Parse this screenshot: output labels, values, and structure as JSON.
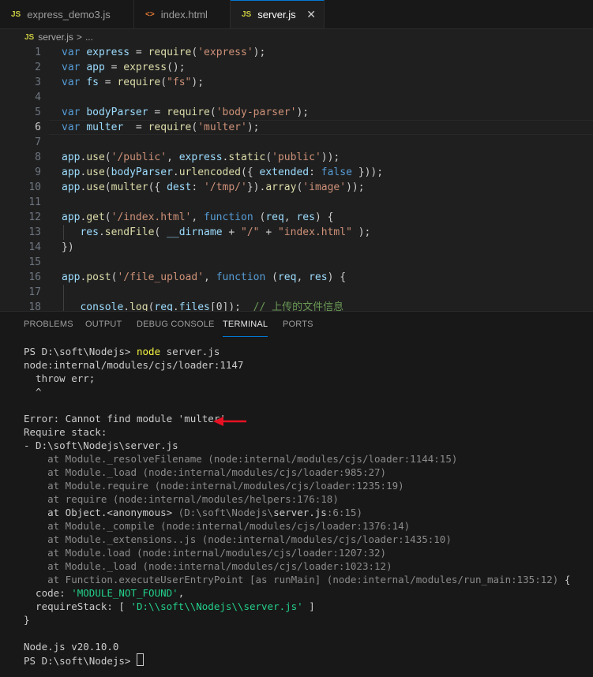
{
  "tabs": [
    {
      "icon": "JS",
      "label": "express_demo3.js",
      "active": false
    },
    {
      "icon": "<>",
      "label": "index.html",
      "active": false
    },
    {
      "icon": "JS",
      "label": "server.js",
      "active": true
    }
  ],
  "tab_close": "✕",
  "breadcrumb": {
    "icon": "JS",
    "file": "server.js",
    "sep": ">",
    "rest": "..."
  },
  "code_lines": [
    {
      "n": "1",
      "tokens": [
        [
          "kw",
          "var"
        ],
        [
          "p",
          " "
        ],
        [
          "var",
          "express"
        ],
        [
          "p",
          " = "
        ],
        [
          "fn",
          "require"
        ],
        [
          "p",
          "("
        ],
        [
          "str",
          "'express'"
        ],
        [
          "p",
          ");"
        ]
      ]
    },
    {
      "n": "2",
      "tokens": [
        [
          "kw",
          "var"
        ],
        [
          "p",
          " "
        ],
        [
          "var",
          "app"
        ],
        [
          "p",
          " = "
        ],
        [
          "fn",
          "express"
        ],
        [
          "p",
          "();"
        ]
      ]
    },
    {
      "n": "3",
      "tokens": [
        [
          "kw",
          "var"
        ],
        [
          "p",
          " "
        ],
        [
          "var",
          "fs"
        ],
        [
          "p",
          " = "
        ],
        [
          "fn",
          "require"
        ],
        [
          "p",
          "("
        ],
        [
          "str",
          "\"fs\""
        ],
        [
          "p",
          ");"
        ]
      ]
    },
    {
      "n": "4",
      "tokens": []
    },
    {
      "n": "5",
      "tokens": [
        [
          "kw",
          "var"
        ],
        [
          "p",
          " "
        ],
        [
          "var",
          "bodyParser"
        ],
        [
          "p",
          " = "
        ],
        [
          "fn",
          "require"
        ],
        [
          "p",
          "("
        ],
        [
          "str",
          "'body-parser'"
        ],
        [
          "p",
          ");"
        ]
      ]
    },
    {
      "n": "6",
      "tokens": [
        [
          "kw",
          "var"
        ],
        [
          "p",
          " "
        ],
        [
          "var",
          "multer"
        ],
        [
          "p",
          "  = "
        ],
        [
          "fn",
          "require"
        ],
        [
          "p",
          "("
        ],
        [
          "str",
          "'multer'"
        ],
        [
          "p",
          ");"
        ]
      ]
    },
    {
      "n": "7",
      "tokens": []
    },
    {
      "n": "8",
      "tokens": [
        [
          "var",
          "app"
        ],
        [
          "p",
          "."
        ],
        [
          "fn",
          "use"
        ],
        [
          "p",
          "("
        ],
        [
          "str",
          "'/public'"
        ],
        [
          "p",
          ", "
        ],
        [
          "var",
          "express"
        ],
        [
          "p",
          "."
        ],
        [
          "fn",
          "static"
        ],
        [
          "p",
          "("
        ],
        [
          "str",
          "'public'"
        ],
        [
          "p",
          "));"
        ]
      ]
    },
    {
      "n": "9",
      "tokens": [
        [
          "var",
          "app"
        ],
        [
          "p",
          "."
        ],
        [
          "fn",
          "use"
        ],
        [
          "p",
          "("
        ],
        [
          "var",
          "bodyParser"
        ],
        [
          "p",
          "."
        ],
        [
          "fn",
          "urlencoded"
        ],
        [
          "p",
          "({ "
        ],
        [
          "var",
          "extended"
        ],
        [
          "p",
          ": "
        ],
        [
          "kw",
          "false"
        ],
        [
          "p",
          " }));"
        ]
      ]
    },
    {
      "n": "10",
      "tokens": [
        [
          "var",
          "app"
        ],
        [
          "p",
          "."
        ],
        [
          "fn",
          "use"
        ],
        [
          "p",
          "("
        ],
        [
          "fn",
          "multer"
        ],
        [
          "p",
          "({ "
        ],
        [
          "var",
          "dest"
        ],
        [
          "p",
          ": "
        ],
        [
          "str",
          "'/tmp/'"
        ],
        [
          "p",
          "})."
        ],
        [
          "fn",
          "array"
        ],
        [
          "p",
          "("
        ],
        [
          "str",
          "'image'"
        ],
        [
          "p",
          "));"
        ]
      ]
    },
    {
      "n": "11",
      "tokens": []
    },
    {
      "n": "12",
      "tokens": [
        [
          "var",
          "app"
        ],
        [
          "p",
          "."
        ],
        [
          "fn",
          "get"
        ],
        [
          "p",
          "("
        ],
        [
          "str",
          "'/index.html'"
        ],
        [
          "p",
          ", "
        ],
        [
          "kw",
          "function"
        ],
        [
          "p",
          " ("
        ],
        [
          "var",
          "req"
        ],
        [
          "p",
          ", "
        ],
        [
          "var",
          "res"
        ],
        [
          "p",
          ") {"
        ]
      ]
    },
    {
      "n": "13",
      "tokens": [
        [
          "p",
          "   "
        ],
        [
          "var",
          "res"
        ],
        [
          "p",
          "."
        ],
        [
          "fn",
          "sendFile"
        ],
        [
          "p",
          "( "
        ],
        [
          "var",
          "__dirname"
        ],
        [
          "p",
          " + "
        ],
        [
          "str",
          "\"/\""
        ],
        [
          "p",
          " + "
        ],
        [
          "str",
          "\"index.html\""
        ],
        [
          "p",
          " );"
        ]
      ]
    },
    {
      "n": "14",
      "tokens": [
        [
          "p",
          "})"
        ]
      ]
    },
    {
      "n": "15",
      "tokens": []
    },
    {
      "n": "16",
      "tokens": [
        [
          "var",
          "app"
        ],
        [
          "p",
          "."
        ],
        [
          "fn",
          "post"
        ],
        [
          "p",
          "("
        ],
        [
          "str",
          "'/file_upload'"
        ],
        [
          "p",
          ", "
        ],
        [
          "kw",
          "function"
        ],
        [
          "p",
          " ("
        ],
        [
          "var",
          "req"
        ],
        [
          "p",
          ", "
        ],
        [
          "var",
          "res"
        ],
        [
          "p",
          ") {"
        ]
      ]
    },
    {
      "n": "17",
      "tokens": []
    },
    {
      "n": "18",
      "tokens": [
        [
          "p",
          "   "
        ],
        [
          "var",
          "console"
        ],
        [
          "p",
          "."
        ],
        [
          "fn",
          "log"
        ],
        [
          "p",
          "("
        ],
        [
          "var",
          "req"
        ],
        [
          "p",
          "."
        ],
        [
          "var",
          "files"
        ],
        [
          "p",
          "[0]);  "
        ],
        [
          "cm",
          "// 上传的文件信息"
        ]
      ]
    }
  ],
  "panel_tabs": [
    "PROBLEMS",
    "OUTPUT",
    "DEBUG CONSOLE",
    "TERMINAL",
    "PORTS"
  ],
  "terminal": [
    [
      [
        "p",
        "PS D:\\soft\\Nodejs> "
      ],
      [
        "y",
        "node"
      ],
      [
        "p",
        " server.js"
      ]
    ],
    [
      [
        "p",
        "node:internal/modules/cjs/loader:1147"
      ]
    ],
    [
      [
        "p",
        "  throw err;"
      ]
    ],
    [
      [
        "p",
        "  ^"
      ]
    ],
    [],
    [
      [
        "p",
        "Error: Cannot find module 'multer'"
      ]
    ],
    [
      [
        "p",
        "Require stack:"
      ]
    ],
    [
      [
        "p",
        "- D:\\soft\\Nodejs\\server.js"
      ]
    ],
    [
      [
        "d",
        "    at Module._resolveFilename (node:internal/modules/cjs/loader:1144:15)"
      ]
    ],
    [
      [
        "d",
        "    at Module._load (node:internal/modules/cjs/loader:985:27)"
      ]
    ],
    [
      [
        "d",
        "    at Module.require (node:internal/modules/cjs/loader:1235:19)"
      ]
    ],
    [
      [
        "d",
        "    at require (node:internal/modules/helpers:176:18)"
      ]
    ],
    [
      [
        "p",
        "    at Object.<anonymous> "
      ],
      [
        "d",
        "(D:\\soft\\Nodejs\\"
      ],
      [
        "p",
        "server.js"
      ],
      [
        "d",
        ":6:15)"
      ]
    ],
    [
      [
        "d",
        "    at Module._compile (node:internal/modules/cjs/loader:1376:14)"
      ]
    ],
    [
      [
        "d",
        "    at Module._extensions..js (node:internal/modules/cjs/loader:1435:10)"
      ]
    ],
    [
      [
        "d",
        "    at Module.load (node:internal/modules/cjs/loader:1207:32)"
      ]
    ],
    [
      [
        "d",
        "    at Module._load (node:internal/modules/cjs/loader:1023:12)"
      ]
    ],
    [
      [
        "d",
        "    at Function.executeUserEntryPoint [as runMain] (node:internal/modules/run_main:135:12)"
      ],
      [
        "p",
        " {"
      ]
    ],
    [
      [
        "p",
        "  code: "
      ],
      [
        "g",
        "'MODULE_NOT_FOUND'"
      ],
      [
        "p",
        ","
      ]
    ],
    [
      [
        "p",
        "  requireStack: [ "
      ],
      [
        "g",
        "'D:\\\\soft\\\\Nodejs\\\\server.js'"
      ],
      [
        "p",
        " ]"
      ]
    ],
    [
      [
        "p",
        "}"
      ]
    ],
    [],
    [
      [
        "p",
        "Node.js v20.10.0"
      ]
    ],
    [
      [
        "p",
        "PS D:\\soft\\Nodejs> "
      ]
    ]
  ],
  "colors": {
    "accent": "#0078d4",
    "arrow": "#e81123"
  }
}
